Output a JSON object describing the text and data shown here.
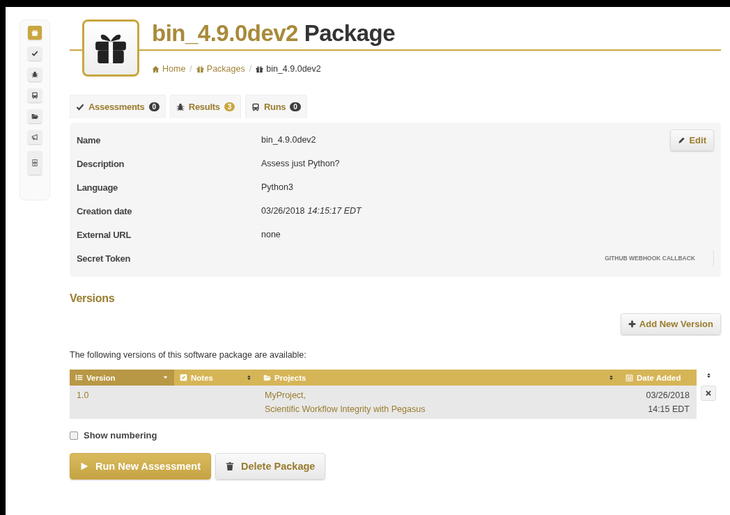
{
  "sidebar": {
    "items": [
      {
        "kind": "gift",
        "selected": true
      },
      {
        "kind": "check",
        "selected": false
      },
      {
        "kind": "bug",
        "selected": false
      },
      {
        "kind": "bus",
        "selected": false
      },
      {
        "kind": "folder",
        "selected": false
      },
      {
        "kind": "megaphone",
        "selected": false
      },
      {
        "kind": "panels",
        "selected": false
      }
    ]
  },
  "header": {
    "name": "bin_4.9.0dev2",
    "suffix": "Package"
  },
  "breadcrumb_separator": "/",
  "breadcrumb": [
    {
      "kind": "home",
      "label": "Home",
      "link": true
    },
    {
      "kind": "gift",
      "label": "Packages",
      "link": true
    },
    {
      "kind": "gift",
      "label": "bin_4.9.0dev2",
      "link": false
    }
  ],
  "tabs": [
    {
      "kind": "check",
      "label": "Assessments",
      "count": "0",
      "color": "#3d3d3d"
    },
    {
      "kind": "bug",
      "label": "Results",
      "count": "3",
      "color": "#c9a640"
    },
    {
      "kind": "bus",
      "label": "Runs",
      "count": "0",
      "color": "#3d3d3d"
    }
  ],
  "details": {
    "edit_button": "Edit",
    "webhook_button": "GITHUB WEBHOOK CALLBACK",
    "rows": [
      {
        "label": "Name",
        "value": "bin_4.9.0dev2"
      },
      {
        "label": "Description",
        "value": "Assess just Python?"
      },
      {
        "label": "Language",
        "value": "Python3"
      },
      {
        "label": "Creation date",
        "value": "03/26/2018",
        "time": "14:15:17 EDT"
      },
      {
        "label": "External URL",
        "value": "none"
      },
      {
        "label": "Secret Token"
      }
    ]
  },
  "versions": {
    "title": "Versions",
    "add_button": "Add New Version",
    "intro": "The following versions of this software package are available:",
    "columns": [
      {
        "kind": "list",
        "label": "Version",
        "sorted": true
      },
      {
        "kind": "notes",
        "label": "Notes",
        "sorted": false
      },
      {
        "kind": "folder",
        "label": "Projects",
        "sorted": false
      },
      {
        "kind": "calendar",
        "label": "Date Added",
        "sorted": false
      }
    ],
    "rows": [
      {
        "version": "1.0",
        "projects": [
          "MyProject,",
          "Scientific Workflow Integrity with Pegasus"
        ],
        "date": "03/26/2018",
        "time": "14:15 EDT"
      }
    ],
    "show_numbering": {
      "label": "Show numbering",
      "checked": false
    }
  },
  "actions": {
    "run": "Run New Assessment",
    "delete": "Delete Package"
  }
}
